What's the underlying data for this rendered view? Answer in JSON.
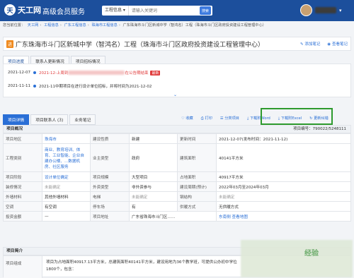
{
  "header": {
    "logo_text": "天工网",
    "logo_mark": "天",
    "vip_text": "高级会员服务",
    "search_type": "工程信息 ▾",
    "search_placeholder": "请输入关键词",
    "search_button": "搜索"
  },
  "breadcrumb": [
    "您当前位置：",
    "天工网",
    "工程信息",
    "广东工程信息",
    "珠海市工程信息",
    "广东珠海市斗门区新城中学（智鸿名）工程（珠海市斗门区政府投资建设工程管理中心）"
  ],
  "project": {
    "badge": "进",
    "title": "广东珠海市斗门区新城中学（智鸿名）工程（珠海市斗门区政府投资建设工程管理中心）",
    "actions": [
      "添加笔记",
      "查看笔记"
    ]
  },
  "top_tabs": [
    "项目进度",
    "联系人更新情况",
    "项目招标情况"
  ],
  "timeline": [
    {
      "date": "2021-12-07",
      "text": "2021-12-上周到",
      "suffix": "在公告期结束",
      "tag": "最新"
    },
    {
      "date": "2021-11-11",
      "text": "2021-11中期项目在进行设计单位招标，并将时间为2021-12-02"
    }
  ],
  "expand_label": "⌄",
  "detail_tabs": [
    "项目详情",
    "项目联系人 (3)",
    "业务笔记"
  ],
  "tools": [
    "收藏",
    "打印",
    "分类项目",
    "下载附Word",
    "下载附Excel",
    "更新纠错"
  ],
  "section1": {
    "title": "项目概况",
    "code": "项目编号：790022/5248111"
  },
  "rows": [
    [
      [
        "项目地区",
        "珠海市"
      ],
      [
        "建设性质",
        "新建"
      ],
      [
        "更新时间",
        "2021-12-07(发布时间：2021-11-12)"
      ]
    ],
    [
      [
        "工程类别",
        "商业、教育培训、体育、工业智能、企业自建办公楼、...数据机房、社区服务"
      ],
      [
        "业主类型",
        "政府"
      ],
      [
        "建筑面积",
        "40141平方米"
      ]
    ],
    [
      [
        "项目阶段",
        "设计单位确定"
      ],
      [
        "项目规模",
        "大型项目"
      ],
      [
        "占地面积",
        "40917平方米"
      ]
    ],
    [
      [
        "装修情况",
        "未能确定"
      ],
      [
        "外资类型",
        "非外资参与"
      ],
      [
        "建设周期(预计)",
        "2022年03月至2024年03月"
      ]
    ],
    [
      [
        "外墙材料",
        "其他外墙材料"
      ],
      [
        "电梯",
        "未能确定"
      ],
      [
        "钢结构",
        "未能确定"
      ]
    ],
    [
      [
        "空调",
        "有空调"
      ],
      [
        "停车场",
        "有"
      ],
      [
        "供暖方式",
        "无供暖方式"
      ]
    ],
    [
      [
        "投资金额",
        "—"
      ],
      [
        "项目地址",
        "广东省珠海市斗门区……"
      ],
      [
        "",
        "东南侧  查看地图"
      ]
    ]
  ],
  "section2": {
    "title": "项目简介"
  },
  "intro": {
    "label": "项目组成",
    "text": "项目为占地面积40917.13平方米，总建筑面积40141平方米，建设用地为36个教学班，可提供公办初中学位1800个，包含："
  },
  "watermark": "经验"
}
